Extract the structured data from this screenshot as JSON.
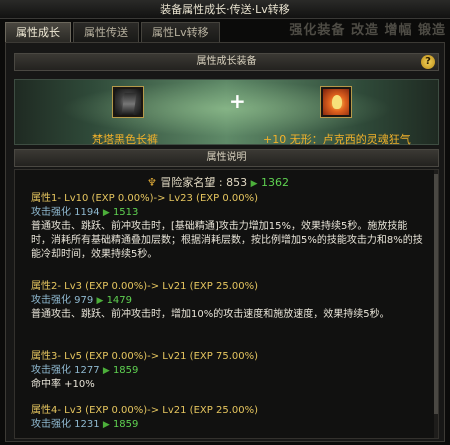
{
  "window_title": "装备属性成长·传送·Lv转移",
  "background_text": "强化装备 改造 增幅 锻造",
  "tabs": [
    {
      "label": "属性成长",
      "active": true
    },
    {
      "label": "属性传送",
      "active": false
    },
    {
      "label": "属性Lv转移",
      "active": false
    }
  ],
  "equip_section": {
    "title": "属性成长装备",
    "help_label": "?",
    "left_item": {
      "name": "梵塔黑色长裤",
      "icon": "pants-icon"
    },
    "plus": "+",
    "right_item": {
      "name": "+10 无形：卢克西的灵魂狂气",
      "icon": "soul-orb-icon"
    }
  },
  "desc_section": {
    "title": "属性说明",
    "fame": {
      "label": "冒险家名望 : 853",
      "to": "1362",
      "icon": "fame-icon"
    },
    "attributes": [
      {
        "title": "属性1- Lv10 (EXP 0.00%)-> Lv23 (EXP 0.00%)",
        "stat_label": "攻击强化 1194",
        "stat_to": "1513",
        "text": "普通攻击、跳跃、前冲攻击时，[基础精通]攻击力增加15%，效果持续5秒。施放技能时，消耗所有基础精通叠加层数；根据消耗层数，按比例增加5%的技能攻击力和8%的技能冷却时间，效果持续5秒。"
      },
      {
        "title": "属性2- Lv3 (EXP 0.00%)-> Lv21 (EXP 25.00%)",
        "stat_label": "攻击强化 979",
        "stat_to": "1479",
        "text": "普通攻击、跳跃、前冲攻击时，增加10%的攻击速度和施放速度，效果持续5秒。"
      },
      {
        "title": "属性3- Lv5 (EXP 0.00%)-> Lv21 (EXP 75.00%)",
        "stat_label": "攻击强化 1277",
        "stat_to": "1859",
        "text": "命中率 +10%"
      },
      {
        "title": "属性4- Lv3 (EXP 0.00%)-> Lv21 (EXP 25.00%)",
        "stat_label": "攻击强化 1231",
        "stat_to": "1859",
        "text": ""
      }
    ]
  }
}
